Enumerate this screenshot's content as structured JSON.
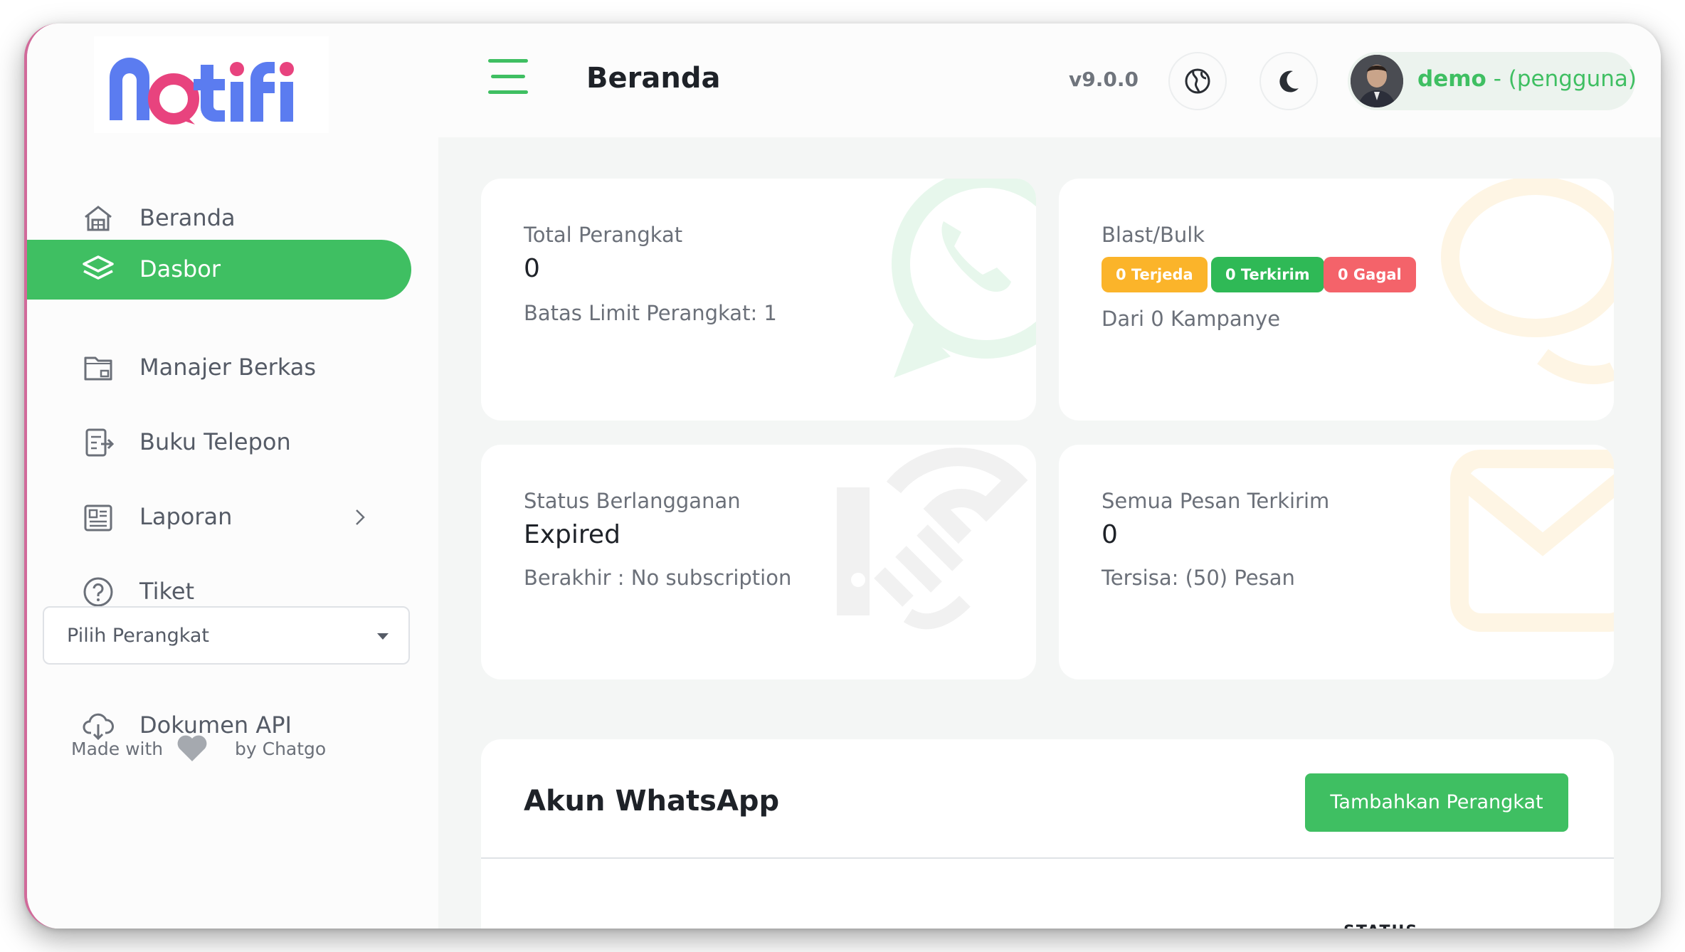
{
  "app": {
    "logo_text": "notifi",
    "version": "v9.0.0",
    "page_title": "Beranda",
    "accent": "#3fbf62"
  },
  "sidebar": {
    "items": [
      {
        "label": "Beranda",
        "icon": "home-icon"
      },
      {
        "label": "Dasbor",
        "icon": "layers-icon",
        "active": true
      },
      {
        "label": "Manajer Berkas",
        "icon": "folder-icon"
      },
      {
        "label": "Buku Telepon",
        "icon": "phonebook-icon"
      },
      {
        "label": "Laporan",
        "icon": "report-icon",
        "has_submenu": true
      },
      {
        "label": "Tiket",
        "icon": "help-icon"
      }
    ],
    "device_select": {
      "value": "Pilih Perangkat"
    },
    "api_doc": {
      "label": "Dokumen API",
      "icon": "cloud-download-icon"
    },
    "footer": {
      "made_with": "Made with",
      "by": "by Chatgo"
    }
  },
  "header": {
    "user": {
      "name": "demo",
      "role": "- (pengguna)"
    }
  },
  "cards": {
    "devices": {
      "title": "Total Perangkat",
      "value": "0",
      "sub": "Batas Limit Perangkat: 1"
    },
    "blast": {
      "title": "Blast/Bulk",
      "badges": [
        {
          "label": "0 Terjeda",
          "color": "#fbb42a"
        },
        {
          "label": "0 Terkirim",
          "color": "#2fb956"
        },
        {
          "label": "0 Gagal",
          "color": "#f4636a"
        }
      ],
      "sub": "Dari 0 Kampanye"
    },
    "subscription": {
      "title": "Status Berlangganan",
      "value": "Expired",
      "sub": "Berakhir : No subscription"
    },
    "messages": {
      "title": "Semua Pesan Terkirim",
      "value": "0",
      "sub": "Tersisa: (50) Pesan"
    }
  },
  "whatsapp": {
    "title": "Akun WhatsApp",
    "add_button": "Tambahkan Perangkat",
    "column_status": "STATUS"
  }
}
